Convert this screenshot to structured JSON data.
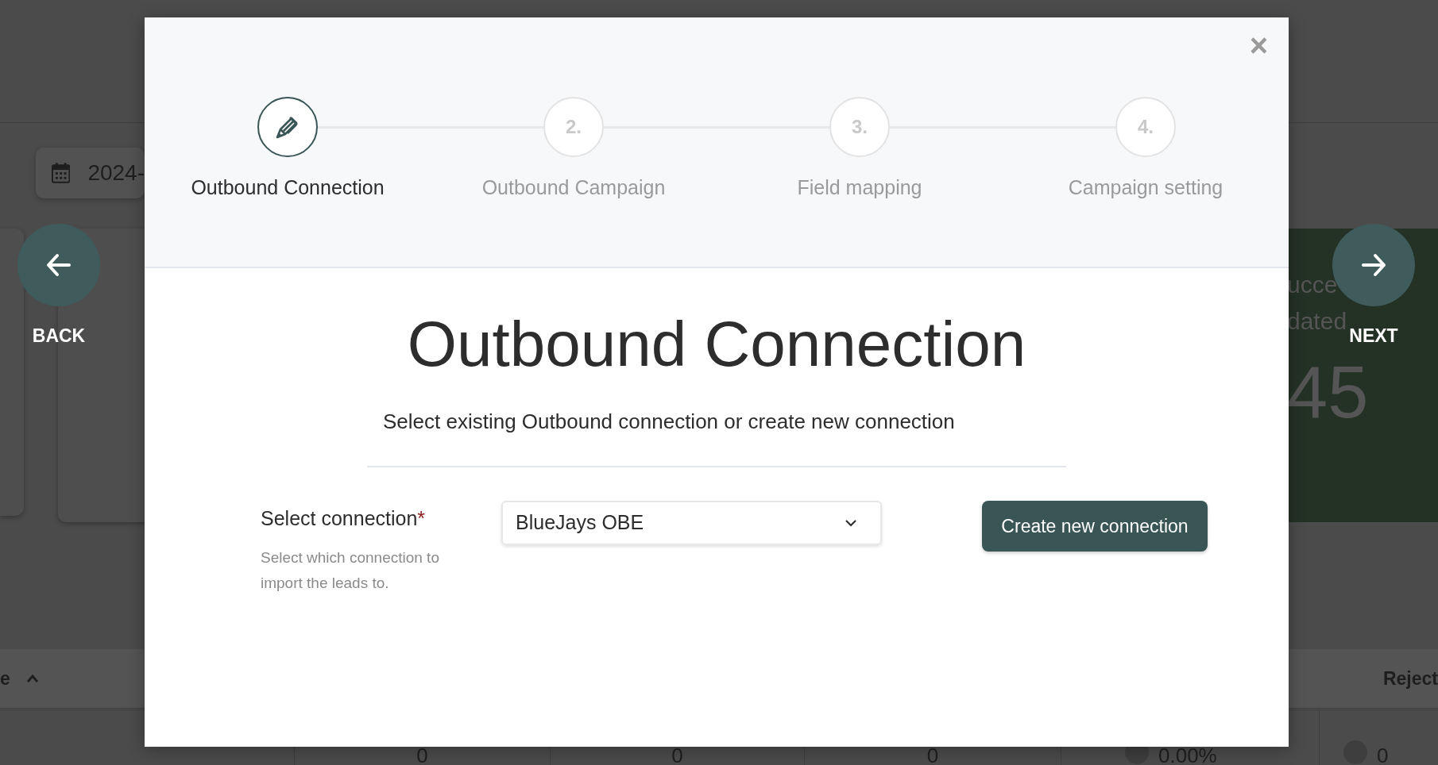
{
  "background": {
    "date_filter": "2024-",
    "stat_card": {
      "label_lines": [
        "ucce",
        "dated"
      ],
      "value": "45"
    },
    "table": {
      "header_fragment": "e",
      "reject_header": "Reject",
      "row_cells": [
        {
          "text": "0",
          "kind": "number"
        },
        {
          "text": "0",
          "kind": "number"
        },
        {
          "text": "0",
          "kind": "number"
        },
        {
          "text": "0.00%",
          "kind": "dot"
        },
        {
          "text": "0",
          "kind": "dot"
        }
      ]
    }
  },
  "nav": [
    {
      "label": "BACK",
      "kind": "back"
    },
    {
      "label": "NEXT",
      "kind": "next"
    }
  ],
  "modal": {
    "close": "×",
    "steps": [
      {
        "label": "Outbound Connection",
        "selected": true
      },
      {
        "number": "2.",
        "label": "Outbound Campaign",
        "selected": false
      },
      {
        "number": "3.",
        "label": "Field mapping",
        "selected": false
      },
      {
        "number": "4.",
        "label": "Campaign setting",
        "selected": false
      }
    ],
    "title": "Outbound Connection",
    "subtitle": "Select existing Outbound connection or create new connection",
    "field": {
      "label": "Select connection",
      "required_mark": "*",
      "help": "Select which connection to import the leads to.",
      "value": "BlueJays OBE"
    },
    "button": "Create new connection"
  }
}
